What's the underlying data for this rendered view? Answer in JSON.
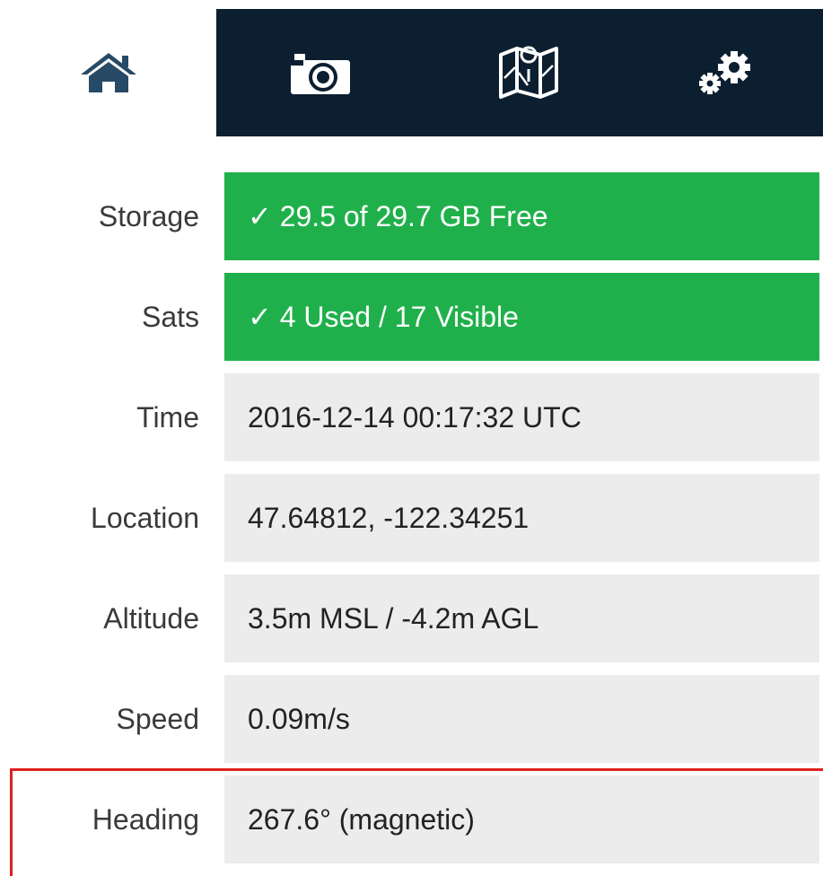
{
  "tabs": [
    {
      "name": "home",
      "icon": "home-icon",
      "active": true
    },
    {
      "name": "camera",
      "icon": "camera-icon",
      "active": false
    },
    {
      "name": "map",
      "icon": "map-icon",
      "active": false
    },
    {
      "name": "settings",
      "icon": "gears-icon",
      "active": false
    }
  ],
  "colors": {
    "tabbar_dark": "#0c1f30",
    "home_icon": "#274a66",
    "ok_green": "#20b04b",
    "value_gray": "#ececec",
    "highlight_red": "#e02020"
  },
  "status": {
    "storage": {
      "label": "Storage",
      "value": "✓ 29.5 of 29.7 GB Free"
    },
    "sats": {
      "label": "Sats",
      "value": "✓ 4 Used / 17 Visible"
    },
    "time": {
      "label": "Time",
      "value": "2016-12-14 00:17:32 UTC"
    },
    "location": {
      "label": "Location",
      "value": "47.64812, -122.34251"
    },
    "altitude": {
      "label": "Altitude",
      "value": "3.5m MSL / -4.2m AGL"
    },
    "speed": {
      "label": "Speed",
      "value": "0.09m/s"
    },
    "heading": {
      "label": "Heading",
      "value": "267.6° (magnetic)"
    }
  }
}
